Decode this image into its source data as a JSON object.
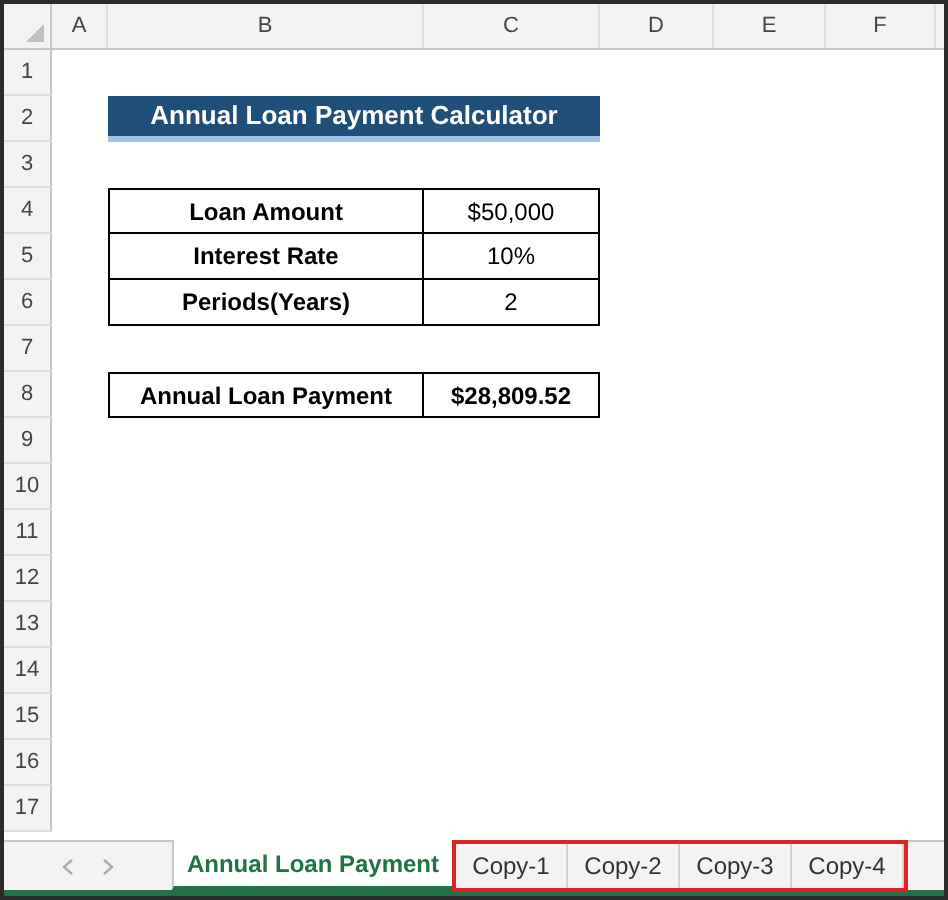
{
  "columns": [
    "A",
    "B",
    "C",
    "D",
    "E",
    "F"
  ],
  "rows": [
    {
      "number": "1",
      "kind": "empty"
    },
    {
      "number": "2",
      "kind": "title",
      "text": "Annual Loan Payment Calculator"
    },
    {
      "number": "3",
      "kind": "empty"
    },
    {
      "number": "4",
      "kind": "pair",
      "label": "Loan Amount",
      "value": "$50,000"
    },
    {
      "number": "5",
      "kind": "pair",
      "label": "Interest Rate",
      "value": "10%"
    },
    {
      "number": "6",
      "kind": "pair",
      "label": "Periods(Years)",
      "value": "2"
    },
    {
      "number": "7",
      "kind": "empty"
    },
    {
      "number": "8",
      "kind": "result",
      "label": "Annual Loan Payment",
      "value": "$28,809.52"
    },
    {
      "number": "9",
      "kind": "empty"
    },
    {
      "number": "10",
      "kind": "empty"
    },
    {
      "number": "11",
      "kind": "empty"
    },
    {
      "number": "12",
      "kind": "empty"
    },
    {
      "number": "13",
      "kind": "empty"
    },
    {
      "number": "14",
      "kind": "empty"
    },
    {
      "number": "15",
      "kind": "empty"
    },
    {
      "number": "16",
      "kind": "empty"
    },
    {
      "number": "17",
      "kind": "empty"
    }
  ],
  "sheet_tabs": [
    {
      "label": "Annual Loan Payment",
      "selected": true,
      "highlighted": false
    },
    {
      "label": "Copy-1",
      "selected": false,
      "highlighted": true
    },
    {
      "label": "Copy-2",
      "selected": false,
      "highlighted": true
    },
    {
      "label": "Copy-3",
      "selected": false,
      "highlighted": true
    },
    {
      "label": "Copy-4",
      "selected": false,
      "highlighted": true
    }
  ]
}
